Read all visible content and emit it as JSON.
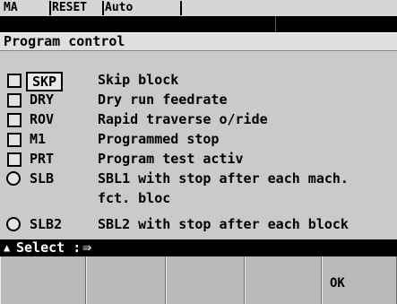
{
  "status_bar": {
    "mode": "MA",
    "reset": "RESET",
    "auto": "Auto"
  },
  "section": {
    "title": "Program control"
  },
  "options": [
    {
      "type": "checkbox",
      "code": "SKP",
      "desc": "Skip block",
      "selected": true
    },
    {
      "type": "checkbox",
      "code": "DRY",
      "desc": "Dry run feedrate"
    },
    {
      "type": "checkbox",
      "code": "ROV",
      "desc": "Rapid traverse o/ride"
    },
    {
      "type": "checkbox",
      "code": "M1",
      "desc": "Programmed stop"
    },
    {
      "type": "checkbox",
      "code": "PRT",
      "desc": "Program test activ"
    },
    {
      "type": "radio",
      "code": "SLB",
      "desc": "SBL1 with stop after each mach.",
      "desc2": "fct. bloc"
    },
    {
      "type": "radio",
      "code": "SLB2",
      "desc": "SBL2 with stop after each block"
    }
  ],
  "select_bar": {
    "arrow": "▲",
    "label": "Select :",
    "symbol": "⇛"
  },
  "softkeys": [
    "",
    "",
    "",
    "",
    "OK"
  ]
}
